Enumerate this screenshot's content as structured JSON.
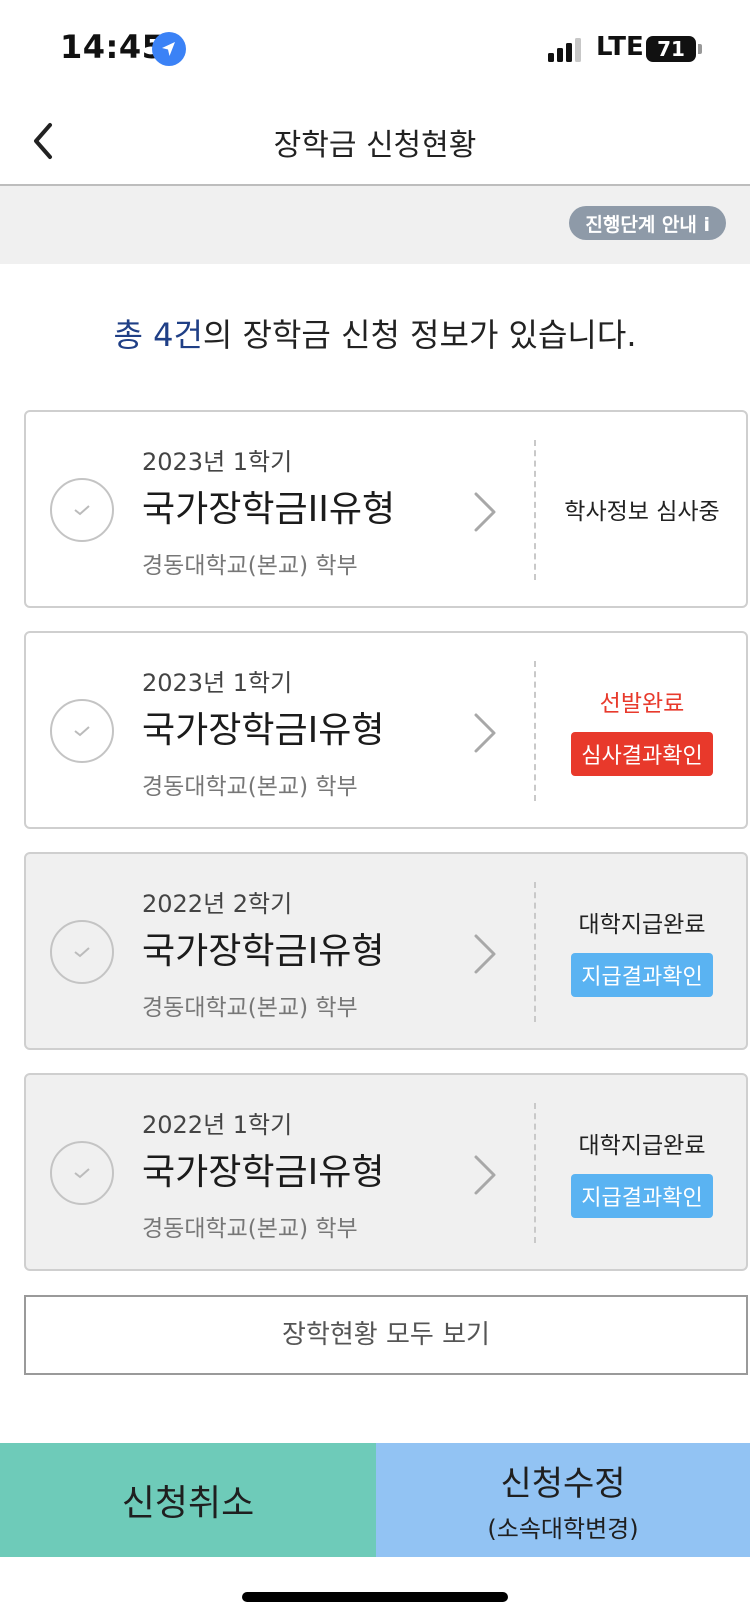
{
  "status_bar": {
    "time": "14:45",
    "network": "LTE",
    "battery": "71"
  },
  "header": {
    "title": "장학금 신청현황"
  },
  "guide": {
    "label": "진행단계 안내 i"
  },
  "summary": {
    "accent": "총 4건",
    "rest": "의 장학금 신청 정보가 있습니다."
  },
  "applications": [
    {
      "term": "2023년 1학기",
      "name": "국가장학금II유형",
      "school": "경동대학교(본교) 학부",
      "status": "학사정보 심사중",
      "action": ""
    },
    {
      "term": "2023년 1학기",
      "name": "국가장학금I유형",
      "school": "경동대학교(본교) 학부",
      "status": "선발완료",
      "action": "심사결과확인"
    },
    {
      "term": "2022년 2학기",
      "name": "국가장학금I유형",
      "school": "경동대학교(본교) 학부",
      "status": "대학지급완료",
      "action": "지급결과확인"
    },
    {
      "term": "2022년 1학기",
      "name": "국가장학금I유형",
      "school": "경동대학교(본교) 학부",
      "status": "대학지급완료",
      "action": "지급결과확인"
    }
  ],
  "view_all": {
    "label": "장학현황 모두 보기"
  },
  "bottom": {
    "cancel_label": "신청취소",
    "modify_label": "신청수정",
    "modify_sub": "(소속대학변경)"
  },
  "colors": {
    "accent_navy": "#1f3f86",
    "status_red": "#e8392b",
    "action_blue": "#5ab3f2",
    "cancel_teal": "#6ecbb9",
    "modify_blue": "#92c3f3"
  },
  "icons": {
    "back": "chevron-left-icon",
    "location": "location-arrow-icon",
    "check": "check-circle-icon",
    "card_arrow": "chevron-right-icon"
  }
}
